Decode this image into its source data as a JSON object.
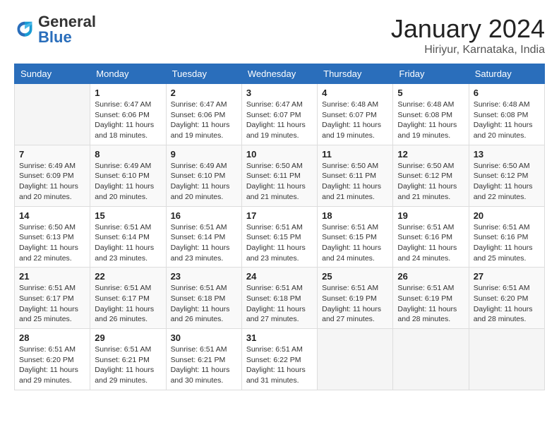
{
  "logo": {
    "general": "General",
    "blue": "Blue"
  },
  "title": "January 2024",
  "subtitle": "Hiriyur, Karnataka, India",
  "days_of_week": [
    "Sunday",
    "Monday",
    "Tuesday",
    "Wednesday",
    "Thursday",
    "Friday",
    "Saturday"
  ],
  "weeks": [
    [
      {
        "day": "",
        "info": ""
      },
      {
        "day": "1",
        "info": "Sunrise: 6:47 AM\nSunset: 6:06 PM\nDaylight: 11 hours\nand 18 minutes."
      },
      {
        "day": "2",
        "info": "Sunrise: 6:47 AM\nSunset: 6:06 PM\nDaylight: 11 hours\nand 19 minutes."
      },
      {
        "day": "3",
        "info": "Sunrise: 6:47 AM\nSunset: 6:07 PM\nDaylight: 11 hours\nand 19 minutes."
      },
      {
        "day": "4",
        "info": "Sunrise: 6:48 AM\nSunset: 6:07 PM\nDaylight: 11 hours\nand 19 minutes."
      },
      {
        "day": "5",
        "info": "Sunrise: 6:48 AM\nSunset: 6:08 PM\nDaylight: 11 hours\nand 19 minutes."
      },
      {
        "day": "6",
        "info": "Sunrise: 6:48 AM\nSunset: 6:08 PM\nDaylight: 11 hours\nand 20 minutes."
      }
    ],
    [
      {
        "day": "7",
        "info": "Sunrise: 6:49 AM\nSunset: 6:09 PM\nDaylight: 11 hours\nand 20 minutes."
      },
      {
        "day": "8",
        "info": "Sunrise: 6:49 AM\nSunset: 6:10 PM\nDaylight: 11 hours\nand 20 minutes."
      },
      {
        "day": "9",
        "info": "Sunrise: 6:49 AM\nSunset: 6:10 PM\nDaylight: 11 hours\nand 20 minutes."
      },
      {
        "day": "10",
        "info": "Sunrise: 6:50 AM\nSunset: 6:11 PM\nDaylight: 11 hours\nand 21 minutes."
      },
      {
        "day": "11",
        "info": "Sunrise: 6:50 AM\nSunset: 6:11 PM\nDaylight: 11 hours\nand 21 minutes."
      },
      {
        "day": "12",
        "info": "Sunrise: 6:50 AM\nSunset: 6:12 PM\nDaylight: 11 hours\nand 21 minutes."
      },
      {
        "day": "13",
        "info": "Sunrise: 6:50 AM\nSunset: 6:12 PM\nDaylight: 11 hours\nand 22 minutes."
      }
    ],
    [
      {
        "day": "14",
        "info": "Sunrise: 6:50 AM\nSunset: 6:13 PM\nDaylight: 11 hours\nand 22 minutes."
      },
      {
        "day": "15",
        "info": "Sunrise: 6:51 AM\nSunset: 6:14 PM\nDaylight: 11 hours\nand 23 minutes."
      },
      {
        "day": "16",
        "info": "Sunrise: 6:51 AM\nSunset: 6:14 PM\nDaylight: 11 hours\nand 23 minutes."
      },
      {
        "day": "17",
        "info": "Sunrise: 6:51 AM\nSunset: 6:15 PM\nDaylight: 11 hours\nand 23 minutes."
      },
      {
        "day": "18",
        "info": "Sunrise: 6:51 AM\nSunset: 6:15 PM\nDaylight: 11 hours\nand 24 minutes."
      },
      {
        "day": "19",
        "info": "Sunrise: 6:51 AM\nSunset: 6:16 PM\nDaylight: 11 hours\nand 24 minutes."
      },
      {
        "day": "20",
        "info": "Sunrise: 6:51 AM\nSunset: 6:16 PM\nDaylight: 11 hours\nand 25 minutes."
      }
    ],
    [
      {
        "day": "21",
        "info": "Sunrise: 6:51 AM\nSunset: 6:17 PM\nDaylight: 11 hours\nand 25 minutes."
      },
      {
        "day": "22",
        "info": "Sunrise: 6:51 AM\nSunset: 6:17 PM\nDaylight: 11 hours\nand 26 minutes."
      },
      {
        "day": "23",
        "info": "Sunrise: 6:51 AM\nSunset: 6:18 PM\nDaylight: 11 hours\nand 26 minutes."
      },
      {
        "day": "24",
        "info": "Sunrise: 6:51 AM\nSunset: 6:18 PM\nDaylight: 11 hours\nand 27 minutes."
      },
      {
        "day": "25",
        "info": "Sunrise: 6:51 AM\nSunset: 6:19 PM\nDaylight: 11 hours\nand 27 minutes."
      },
      {
        "day": "26",
        "info": "Sunrise: 6:51 AM\nSunset: 6:19 PM\nDaylight: 11 hours\nand 28 minutes."
      },
      {
        "day": "27",
        "info": "Sunrise: 6:51 AM\nSunset: 6:20 PM\nDaylight: 11 hours\nand 28 minutes."
      }
    ],
    [
      {
        "day": "28",
        "info": "Sunrise: 6:51 AM\nSunset: 6:20 PM\nDaylight: 11 hours\nand 29 minutes."
      },
      {
        "day": "29",
        "info": "Sunrise: 6:51 AM\nSunset: 6:21 PM\nDaylight: 11 hours\nand 29 minutes."
      },
      {
        "day": "30",
        "info": "Sunrise: 6:51 AM\nSunset: 6:21 PM\nDaylight: 11 hours\nand 30 minutes."
      },
      {
        "day": "31",
        "info": "Sunrise: 6:51 AM\nSunset: 6:22 PM\nDaylight: 11 hours\nand 31 minutes."
      },
      {
        "day": "",
        "info": ""
      },
      {
        "day": "",
        "info": ""
      },
      {
        "day": "",
        "info": ""
      }
    ]
  ]
}
